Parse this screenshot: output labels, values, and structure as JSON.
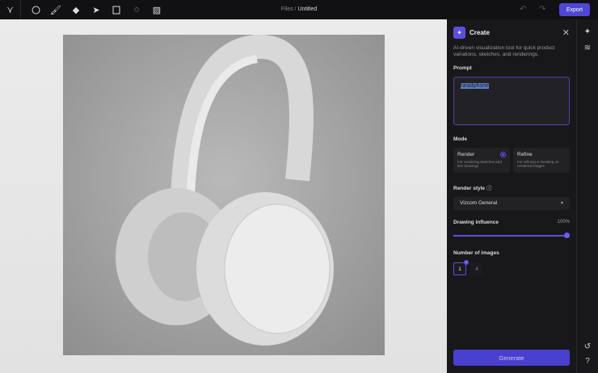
{
  "topbar": {
    "breadcrumb_parent": "Files",
    "breadcrumb_sep": " / ",
    "breadcrumb_current": "Untitled",
    "export_label": "Export"
  },
  "panel": {
    "title": "Create",
    "description": "AI-driven visualization tool for quick product variations, sketches, and renderings.",
    "prompt_label": "Prompt",
    "prompt_value": "headphone",
    "mode_label": "Mode",
    "modes": [
      {
        "label": "Render",
        "desc": "For rendering sketches and line drawings",
        "selected": true
      },
      {
        "label": "Refine",
        "desc": "For refining or iterating on rendered images",
        "selected": false
      }
    ],
    "render_style_label": "Render style",
    "render_style_value": "Vizcom General",
    "influence_label": "Drawing influence",
    "influence_value": "100%",
    "influence_fraction": 1.0,
    "num_images_label": "Number of images",
    "num_options": [
      "1",
      "4"
    ],
    "num_selected": "1",
    "generate_label": "Generate"
  },
  "accent": "#5b4fe0"
}
